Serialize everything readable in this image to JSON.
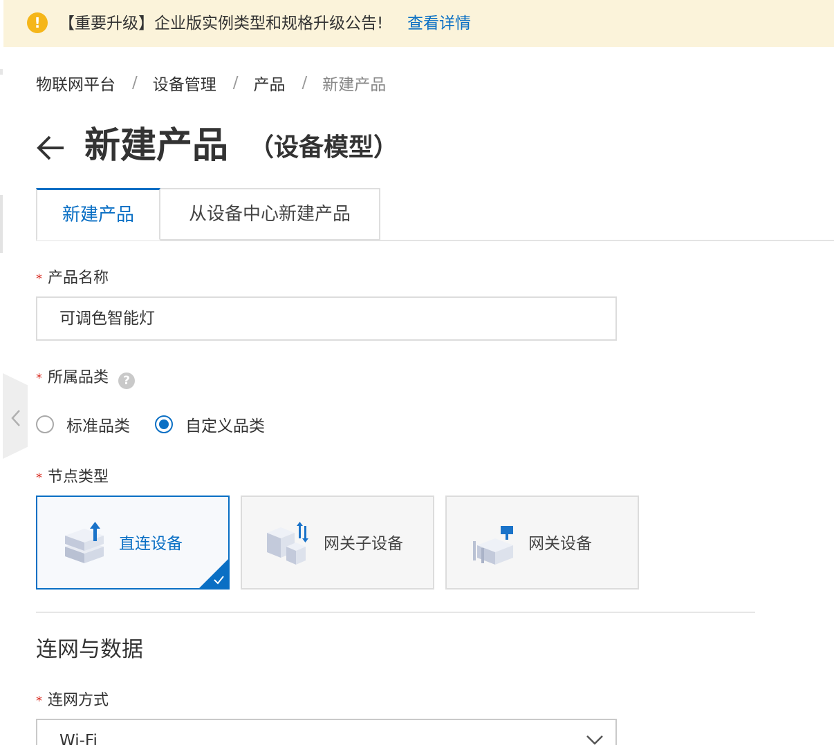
{
  "notice": {
    "icon": "exclamation-circle-icon",
    "icon_glyph": "!",
    "text": "【重要升级】企业版实例类型和规格升级公告!",
    "link_label": "查看详情"
  },
  "breadcrumb": [
    "物联网平台",
    "设备管理",
    "产品",
    "新建产品"
  ],
  "breadcrumb_separator": "/",
  "header": {
    "title": "新建产品",
    "subtitle": "（设备模型）",
    "back_icon": "arrow-left-icon"
  },
  "tabs": [
    {
      "label": "新建产品",
      "active": true
    },
    {
      "label": "从设备中心新建产品",
      "active": false
    }
  ],
  "form": {
    "required_mark": "*",
    "product_name": {
      "label": "产品名称",
      "value": "可调色智能灯"
    },
    "category": {
      "label": "所属品类",
      "help_glyph": "?",
      "options": [
        {
          "label": "标准品类",
          "checked": false
        },
        {
          "label": "自定义品类",
          "checked": true
        }
      ]
    },
    "node_type": {
      "label": "节点类型",
      "options": [
        {
          "label": "直连设备",
          "icon": "direct-device-icon",
          "selected": true
        },
        {
          "label": "网关子设备",
          "icon": "gateway-subdevice-icon",
          "selected": false
        },
        {
          "label": "网关设备",
          "icon": "gateway-device-icon",
          "selected": false
        }
      ]
    }
  },
  "network_section": {
    "title": "连网与数据",
    "network_method": {
      "label": "连网方式",
      "value": "Wi-Fi"
    }
  },
  "colors": {
    "accent": "#0a6fc4",
    "notice_bg": "#fbf3da",
    "warning": "#f5b619",
    "required": "#d93026"
  }
}
